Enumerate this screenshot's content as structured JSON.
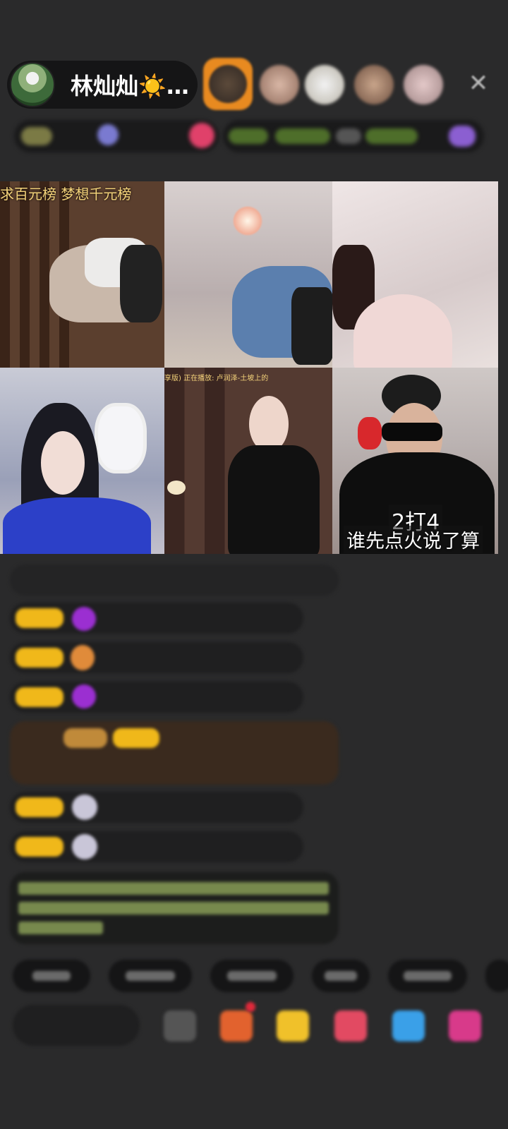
{
  "host": {
    "name": "林灿灿☀️…"
  },
  "video_tiles": [
    {
      "caption": "求百元榜  梦想千元榜"
    },
    {
      "caption": ""
    },
    {
      "caption": ""
    },
    {
      "caption": ""
    },
    {
      "caption": "享版)  正在播放: 卢润泽-土坡上的"
    },
    {
      "overlay_line1": "2打4",
      "overlay_line2": "谁先点火说了算"
    }
  ],
  "colors": {
    "background": "#2a2a2b",
    "caption": "#f4d37a",
    "badge_gold": "#f0b81a",
    "chat_bubble": "#1f1f20"
  }
}
